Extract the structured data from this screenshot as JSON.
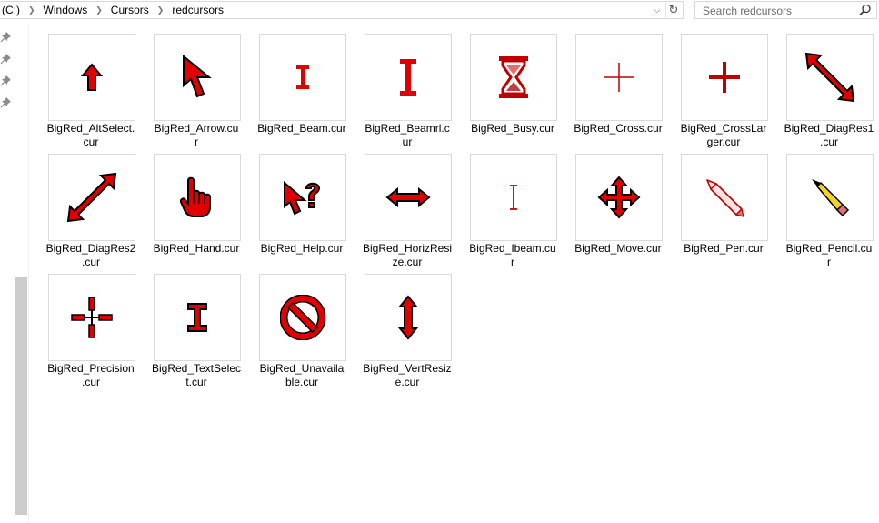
{
  "address": {
    "crumbs": [
      "(C:)",
      "Windows",
      "Cursors",
      "redcursors"
    ]
  },
  "search": {
    "placeholder": "Search redcursors"
  },
  "files": [
    {
      "name1": "BigRed_AltSelect.",
      "name2": "cur",
      "icon": "up-arrow-icon"
    },
    {
      "name1": "BigRed_Arrow.cu",
      "name2": "r",
      "icon": "arrow-pointer-icon"
    },
    {
      "name1": "BigRed_Beam.cur",
      "name2": "",
      "icon": "small-ibeam-icon"
    },
    {
      "name1": "BigRed_Beamrl.c",
      "name2": "ur",
      "icon": "large-ibeam-icon"
    },
    {
      "name1": "BigRed_Busy.cur",
      "name2": "",
      "icon": "hourglass-icon"
    },
    {
      "name1": "BigRed_Cross.cur",
      "name2": "",
      "icon": "thin-cross-icon"
    },
    {
      "name1": "BigRed_CrossLar",
      "name2": "ger.cur",
      "icon": "large-cross-icon"
    },
    {
      "name1": "BigRed_DiagRes1",
      "name2": ".cur",
      "icon": "diag-resize-1-icon"
    },
    {
      "name1": "BigRed_DiagRes2",
      "name2": ".cur",
      "icon": "diag-resize-2-icon"
    },
    {
      "name1": "BigRed_Hand.cur",
      "name2": "",
      "icon": "hand-pointer-icon"
    },
    {
      "name1": "BigRed_Help.cur",
      "name2": "",
      "icon": "help-pointer-icon"
    },
    {
      "name1": "BigRed_HorizResi",
      "name2": "ze.cur",
      "icon": "horiz-resize-icon"
    },
    {
      "name1": "BigRed_Ibeam.cu",
      "name2": "r",
      "icon": "thin-ibeam-icon"
    },
    {
      "name1": "BigRed_Move.cur",
      "name2": "",
      "icon": "move-icon"
    },
    {
      "name1": "BigRed_Pen.cur",
      "name2": "",
      "icon": "pen-icon"
    },
    {
      "name1": "BigRed_Pencil.cu",
      "name2": "r",
      "icon": "pencil-icon"
    },
    {
      "name1": "BigRed_Precision",
      "name2": ".cur",
      "icon": "precision-cross-icon"
    },
    {
      "name1": "BigRed_TextSelec",
      "name2": "t.cur",
      "icon": "text-select-icon"
    },
    {
      "name1": "BigRed_Unavaila",
      "name2": "ble.cur",
      "icon": "unavailable-icon"
    },
    {
      "name1": "BigRed_VertResiz",
      "name2": "e.cur",
      "icon": "vert-resize-icon"
    }
  ],
  "colors": {
    "red": "#e00000",
    "dark": "#000000",
    "yellow": "#f2d32a"
  }
}
